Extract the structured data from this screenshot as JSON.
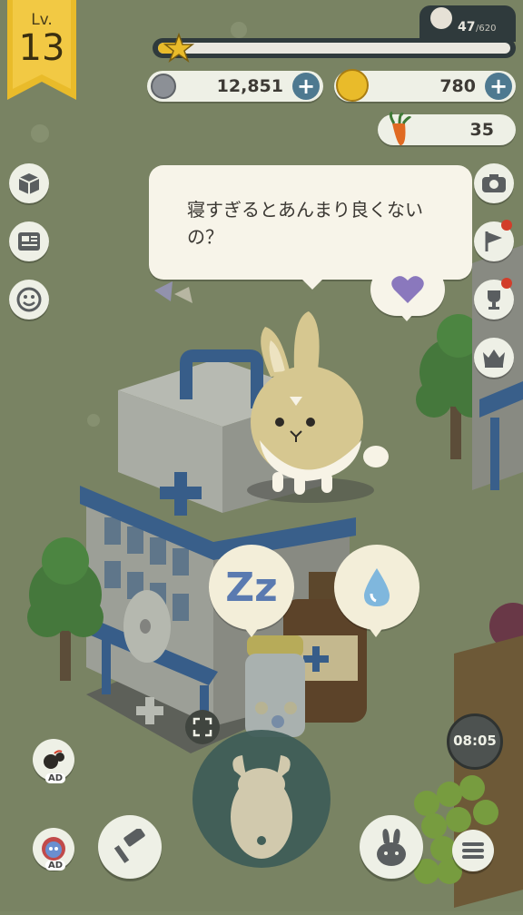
{
  "hud": {
    "level_label": "Lv.",
    "level_value": "13",
    "xp_value": "47",
    "xp_max": "/620",
    "xp_fraction": 0.076,
    "coins": "12,851",
    "gold": "780",
    "carrots": "35"
  },
  "speech": {
    "text": "寝すぎるとあんまり良くないの？"
  },
  "needs": [
    "sleep",
    "water"
  ],
  "timer": "08:05",
  "ad_label_1": "AD",
  "ad_label_2": "AD",
  "colors": {
    "level_ribbon": "#e9bb2a",
    "plus_button": "#4e7990",
    "xp_bar_bg": "#2f3a3c",
    "heart": "#8a78bd"
  }
}
